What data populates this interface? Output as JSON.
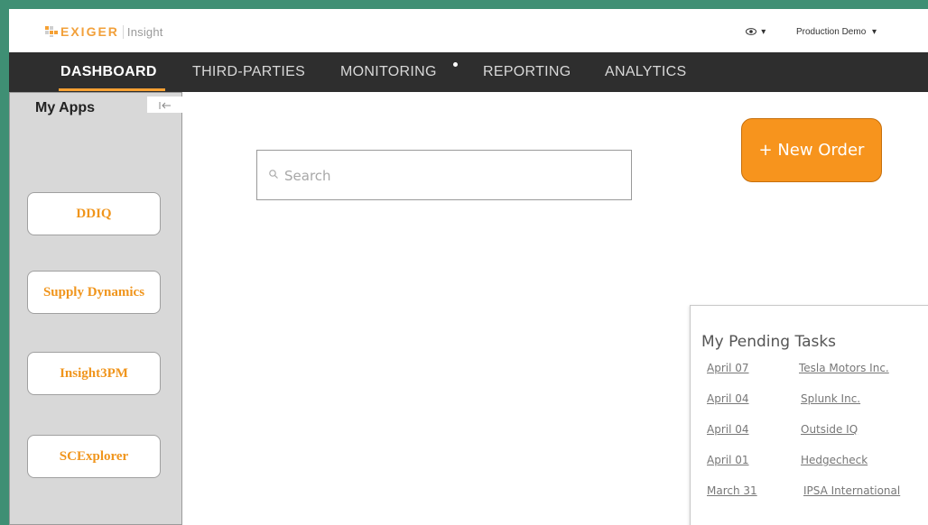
{
  "header": {
    "brand": "EXIGER",
    "product": "Insight",
    "view_menu_caret": "▾",
    "environment": "Production Demo",
    "environment_caret": "▾"
  },
  "nav": {
    "items": [
      {
        "label": "DASHBOARD",
        "active": true
      },
      {
        "label": "THIRD-PARTIES",
        "active": false
      },
      {
        "label": "MONITORING",
        "active": false
      },
      {
        "label": "REPORTING",
        "active": false
      },
      {
        "label": "ANALYTICS",
        "active": false
      }
    ]
  },
  "sidebar": {
    "title": "My Apps",
    "collapse_icon": "collapse-left-icon",
    "apps": [
      "DDIQ",
      "Supply Dynamics",
      "Insight3PM",
      "SCExplorer"
    ]
  },
  "search": {
    "placeholder": "Search",
    "value": ""
  },
  "new_order": {
    "label": "+ New Order"
  },
  "tasks": {
    "title": "My Pending Tasks",
    "items": [
      {
        "date": "April 07",
        "name": "Tesla Motors Inc."
      },
      {
        "date": "April 04",
        "name": "Splunk Inc."
      },
      {
        "date": "April 04",
        "name": "Outside IQ"
      },
      {
        "date": "April 01",
        "name": "Hedgecheck"
      },
      {
        "date": "March 31",
        "name": "IPSA International"
      }
    ]
  },
  "colors": {
    "accent": "#f7941d",
    "nav_bg": "#2e2e2e",
    "sidebar_bg": "#d8d8d8",
    "frame_bg": "#3f8f74"
  }
}
